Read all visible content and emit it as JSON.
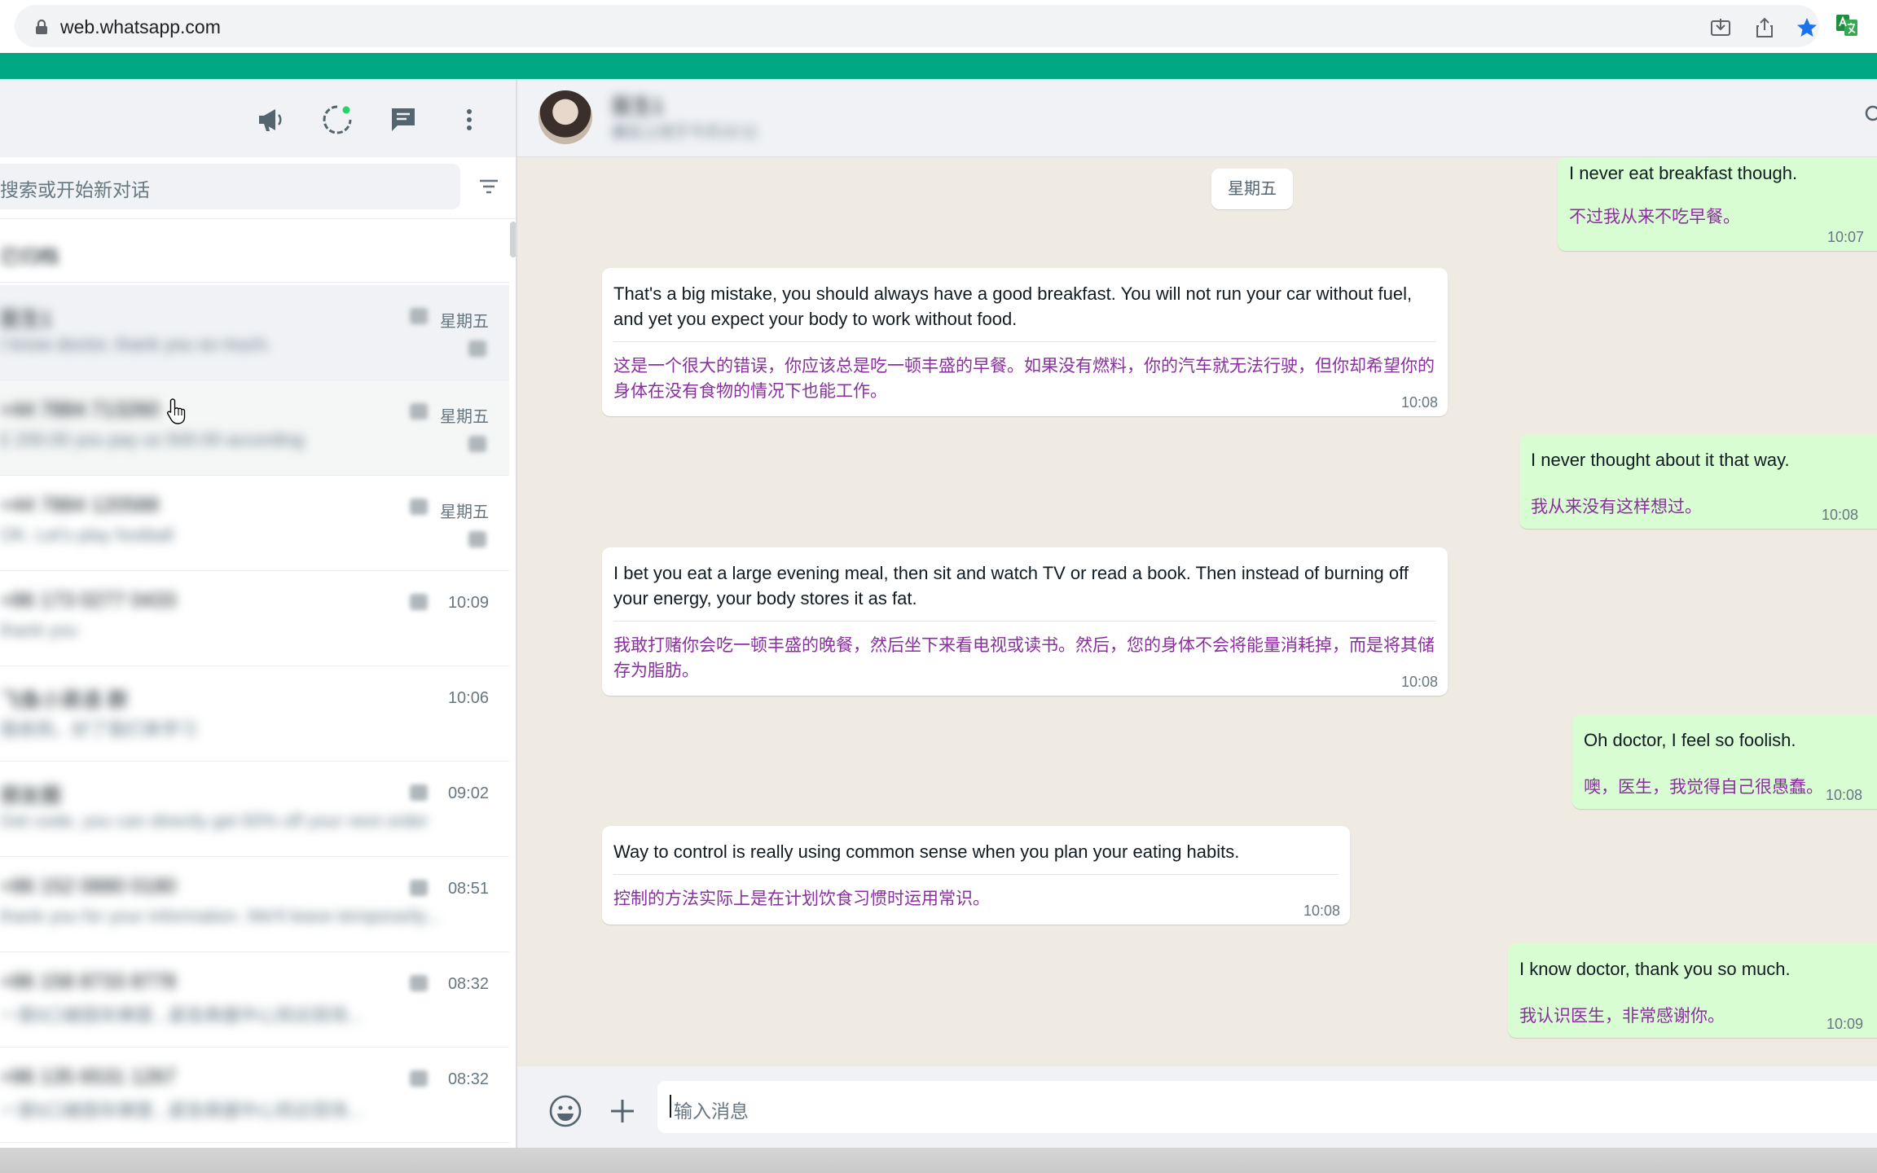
{
  "browser": {
    "url": "web.whatsapp.com"
  },
  "left": {
    "search_placeholder": "搜索或开始新对话",
    "archived_label": "已归档",
    "chats": [
      {
        "name": "医生1",
        "preview": "I know doctor, thank you so much.",
        "time": "星期五"
      },
      {
        "name": "+44 7884 713260",
        "preview": "£ 200.00 you pay us 500.00 according",
        "time": "星期五"
      },
      {
        "name": "+44 7884 120588",
        "preview": "OK. Let's play football",
        "time": "星期五"
      },
      {
        "name": "+86 173 0277 0433",
        "preview": "thank you",
        "time": "10:09"
      },
      {
        "name": "飞鱼小英语 群",
        "preview": "我收到，好了我们来学习",
        "time": "10:06"
      },
      {
        "name": "朋友圈",
        "preview": "Get code, you can directly get 60% off your next order",
        "time": "09:02"
      },
      {
        "name": "+86 152 0880 0180",
        "preview": "thank you for your information. We'll leave temporarily...",
        "time": "08:51"
      },
      {
        "name": "+86 158 8733 8778",
        "preview": "一家6口被困车辆里...紧急救援中心到达现场...",
        "time": "08:32"
      },
      {
        "name": "+86 135 6531 1267",
        "preview": "一家6口被困车辆里...紧急救援中心到达现场...",
        "time": "08:32"
      }
    ]
  },
  "conversation": {
    "contact_name": "医生1",
    "contact_status": "最后上线于今天10:11",
    "date_chip": "星期五",
    "messages": [
      {
        "dir": "out",
        "text": "I never eat breakfast though.",
        "translation": "不过我从来不吃早餐。",
        "time": "10:07"
      },
      {
        "dir": "in",
        "text": "That's a big mistake, you should always have a good breakfast. You will not run your car without fuel, and yet you expect your body to work without food.",
        "translation": "这是一个很大的错误，你应该总是吃一顿丰盛的早餐。如果没有燃料，你的汽车就无法行驶，但你却希望你的身体在没有食物的情况下也能工作。",
        "time": "10:08"
      },
      {
        "dir": "out",
        "text": "I never thought about it that way.",
        "translation": "我从来没有这样想过。",
        "time": "10:08"
      },
      {
        "dir": "in",
        "text": "I bet you eat a large evening meal, then sit and watch TV or read a book. Then instead of burning off your energy, your body stores it as fat.",
        "translation": "我敢打赌你会吃一顿丰盛的晚餐，然后坐下来看电视或读书。然后，您的身体不会将能量消耗掉，而是将其储存为脂肪。",
        "time": "10:08"
      },
      {
        "dir": "out",
        "text": "Oh doctor, I feel so foolish.",
        "translation": "噢，医生，我觉得自己很愚蠢。",
        "time": "10:08"
      },
      {
        "dir": "in",
        "text": "Way to control is really using common sense when you plan your eating habits.",
        "translation": "控制的方法实际上是在计划饮食习惯时运用常识。",
        "time": "10:08"
      },
      {
        "dir": "out",
        "text": "I know doctor, thank you so much.",
        "translation": "我认识医生，非常感谢你。",
        "time": "10:09"
      }
    ],
    "input_placeholder": "输入消息"
  },
  "colors": {
    "brand_green": "#00a884",
    "outgoing_bubble": "#d9fdd3",
    "translation_text": "#8a2f9e",
    "star_blue": "#1a73e8"
  }
}
